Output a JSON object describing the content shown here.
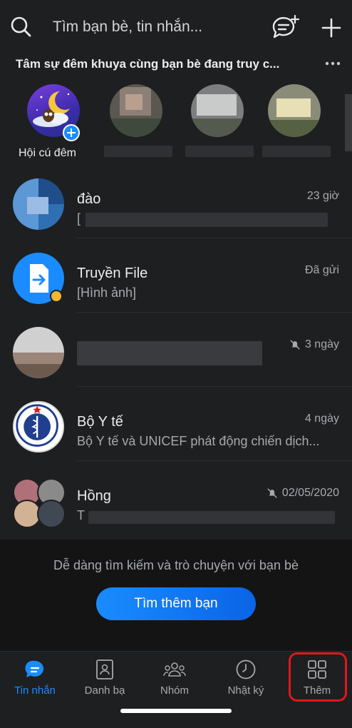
{
  "search": {
    "placeholder": "Tìm bạn bè, tin nhắn..."
  },
  "icons": {
    "search": "search-icon",
    "new_chat": "chat-bubble-plus-icon",
    "add": "plus-icon",
    "more": "ellipsis-icon"
  },
  "stories": {
    "title": "Tâm sự đêm khuya cùng bạn bè đang truy c...",
    "items": [
      {
        "name": "Hội cú đêm"
      }
    ]
  },
  "conversations": [
    {
      "name": "đào",
      "preview": "[",
      "time": "23 giờ",
      "muted": false
    },
    {
      "name": "Truyền File",
      "preview": "[Hình ảnh]",
      "time": "Đã gửi",
      "muted": false
    },
    {
      "name": "",
      "preview": "",
      "time": "3 ngày",
      "muted": true
    },
    {
      "name": "Bộ Y tế",
      "preview": "Bộ Y tế và UNICEF phát động chiến dịch...",
      "time": "4 ngày",
      "muted": false
    },
    {
      "name": "Hồng",
      "preview": "T",
      "time": "02/05/2020",
      "muted": true
    }
  ],
  "promo": {
    "text": "Dễ dàng tìm kiếm và trò chuyện với bạn bè",
    "button_label": "Tìm thêm bạn"
  },
  "tabs": [
    {
      "label": "Tin nhắn",
      "icon": "chat-icon",
      "active": true
    },
    {
      "label": "Danh bạ",
      "icon": "contacts-icon",
      "active": false
    },
    {
      "label": "Nhóm",
      "icon": "group-icon",
      "active": false
    },
    {
      "label": "Nhật ký",
      "icon": "clock-icon",
      "active": false
    },
    {
      "label": "Thêm",
      "icon": "grid-icon",
      "active": false
    }
  ],
  "colors": {
    "accent": "#1a8cff",
    "highlight": "#e0171a",
    "background": "#1e1f21"
  }
}
